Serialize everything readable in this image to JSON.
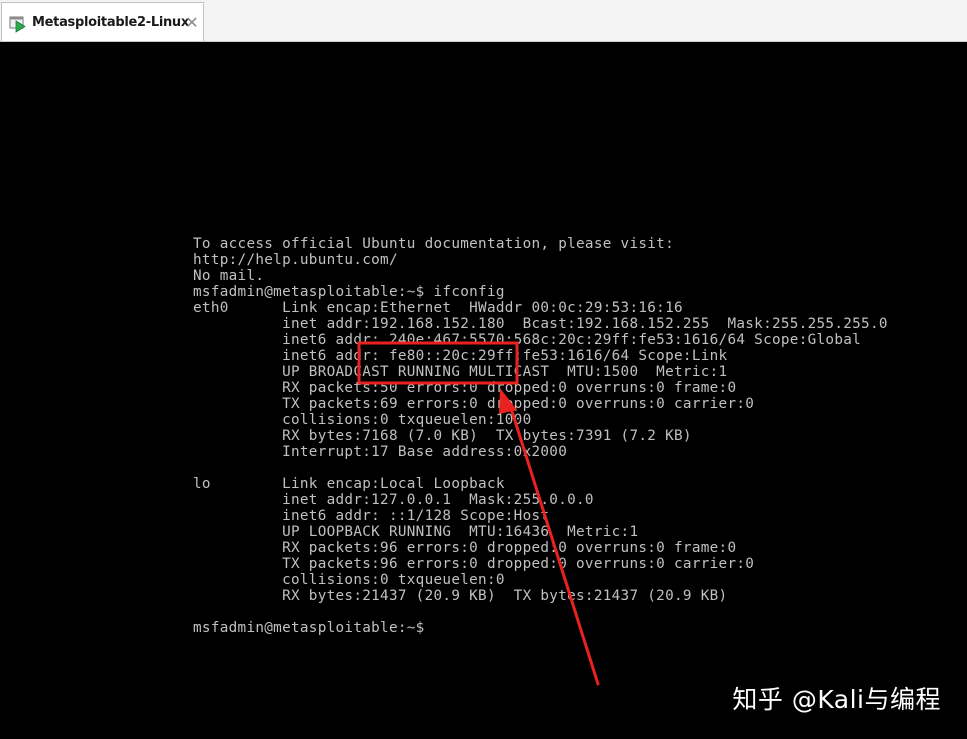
{
  "tab": {
    "title": "Metasploitable2-Linux",
    "close_glyph": "✕",
    "icon": "vm-play-icon"
  },
  "terminal": {
    "lines": [
      "To access official Ubuntu documentation, please visit:",
      "http://help.ubuntu.com/",
      "No mail.",
      "msfadmin@metasploitable:~$ ifconfig",
      "eth0      Link encap:Ethernet  HWaddr 00:0c:29:53:16:16",
      "          inet addr:192.168.152.180  Bcast:192.168.152.255  Mask:255.255.255.0",
      "          inet6 addr: 240e:467:5570:568c:20c:29ff:fe53:1616/64 Scope:Global",
      "          inet6 addr: fe80::20c:29ff:fe53:1616/64 Scope:Link",
      "          UP BROADCAST RUNNING MULTICAST  MTU:1500  Metric:1",
      "          RX packets:50 errors:0 dropped:0 overruns:0 frame:0",
      "          TX packets:69 errors:0 dropped:0 overruns:0 carrier:0",
      "          collisions:0 txqueuelen:1000",
      "          RX bytes:7168 (7.0 KB)  TX bytes:7391 (7.2 KB)",
      "          Interrupt:17 Base address:0x2000",
      "",
      "lo        Link encap:Local Loopback",
      "          inet addr:127.0.0.1  Mask:255.0.0.0",
      "          inet6 addr: ::1/128 Scope:Host",
      "          UP LOOPBACK RUNNING  MTU:16436  Metric:1",
      "          RX packets:96 errors:0 dropped:0 overruns:0 frame:0",
      "          TX packets:96 errors:0 dropped:0 overruns:0 carrier:0",
      "          collisions:0 txqueuelen:0",
      "          RX bytes:21437 (20.9 KB)  TX bytes:21437 (20.9 KB)",
      "",
      "msfadmin@metasploitable:~$"
    ]
  },
  "annotation": {
    "color": "#e8231f",
    "highlighted_text": "192.168.152.180"
  },
  "watermark": {
    "text": "知乎 @Kali与编程"
  }
}
